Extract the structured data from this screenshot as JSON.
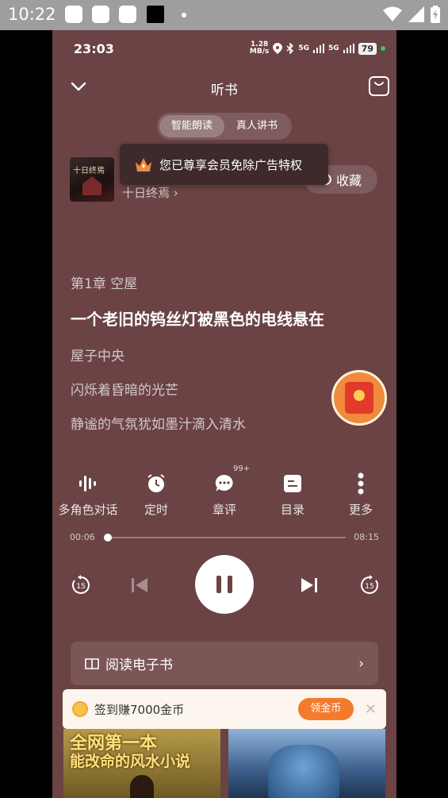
{
  "system_status": {
    "time": "10:22"
  },
  "status_bar": {
    "time": "23:03",
    "net_speed": "1.28",
    "net_unit": "MB/s",
    "signal1": "5G",
    "signal2": "5G",
    "battery": "79"
  },
  "header": {
    "title": "听书"
  },
  "segmented": {
    "option1": "智能朗读",
    "option2": "真人讲书"
  },
  "book": {
    "cover_text": "十日终焉",
    "author": "十日终焉"
  },
  "favorite": {
    "label": "收藏"
  },
  "toast": {
    "text": "您已尊享会员免除广告特权"
  },
  "reader": {
    "chapter": "第1章 空屋",
    "current_line": "一个老旧的钨丝灯被黑色的电线悬在",
    "lines": [
      "屋子中央",
      "闪烁着昏暗的光芒",
      "静谧的气氛犹如墨汁滴入清水"
    ]
  },
  "functions": [
    {
      "label": "多角色对话",
      "icon": "sound-wave-icon"
    },
    {
      "label": "定时",
      "icon": "alarm-clock-icon"
    },
    {
      "label": "章评",
      "icon": "comment-icon",
      "badge": "99+"
    },
    {
      "label": "目录",
      "icon": "catalog-icon"
    },
    {
      "label": "更多",
      "icon": "more-dots-icon"
    }
  ],
  "progress": {
    "current": "00:06",
    "total": "08:15",
    "fraction": 0.012
  },
  "controls": {
    "rewind_label": "15",
    "forward_label": "15"
  },
  "ebook": {
    "label": "阅读电子书"
  },
  "checkin": {
    "label": "签到赚7000金币",
    "button": "领金币"
  },
  "banners": [
    {
      "line1": "全网第一本",
      "line2": "能改命的风水小说"
    }
  ],
  "colors": {
    "background": "#6b4344",
    "accent": "#f47a2c"
  }
}
